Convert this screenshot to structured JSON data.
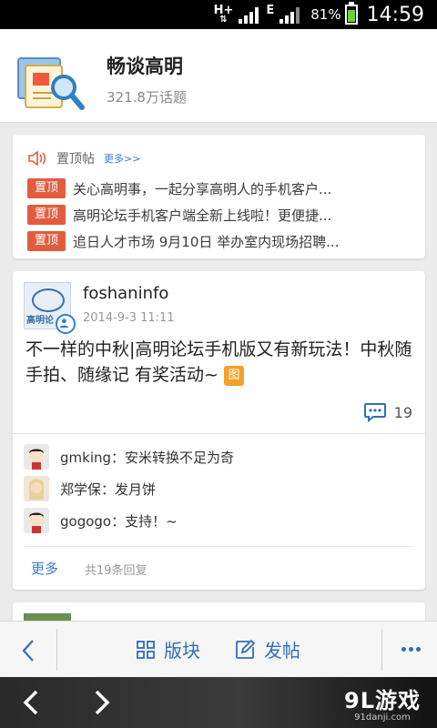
{
  "status_bar": {
    "network": "H+",
    "network2": "E",
    "battery": "81%",
    "battery_level": 0.81,
    "time": "14:59"
  },
  "forum": {
    "title": "畅谈高明",
    "topic_count": "321.8万话题"
  },
  "sticky": {
    "label": "置顶帖",
    "more": "更多>>",
    "items": [
      {
        "tag": "置顶",
        "text": "关心高明事，一起分享高明人的手机客户..."
      },
      {
        "tag": "置顶",
        "text": "高明论坛手机客户端全新上线啦！更便捷..."
      },
      {
        "tag": "置顶",
        "text": "追日人才市场 9月10日 举办室内现场招聘..."
      }
    ]
  },
  "post": {
    "author": "foshaninfo",
    "avatar_text": "高明论",
    "date": "2014-9-3 11:11",
    "body": "不一样的中秋|高明论坛手机版又有新玩法！中秋随手拍、随缘记 有奖活动~",
    "image_tag": "图",
    "reply_count": "19",
    "comments": [
      {
        "text": "gmking：安米转换不足为奇"
      },
      {
        "text": "郑学保：发月饼"
      },
      {
        "text": "gogogo：支持！~"
      }
    ],
    "more": "更多",
    "total_replies": "共19条回复"
  },
  "toolbar": {
    "boards": "版块",
    "compose": "发帖"
  },
  "watermark": {
    "main": "9L游戏",
    "sub": "91danji.com"
  },
  "colors": {
    "accent": "#2f6fb8",
    "tag": "#e25d3f",
    "image_tag": "#f2a12a"
  }
}
